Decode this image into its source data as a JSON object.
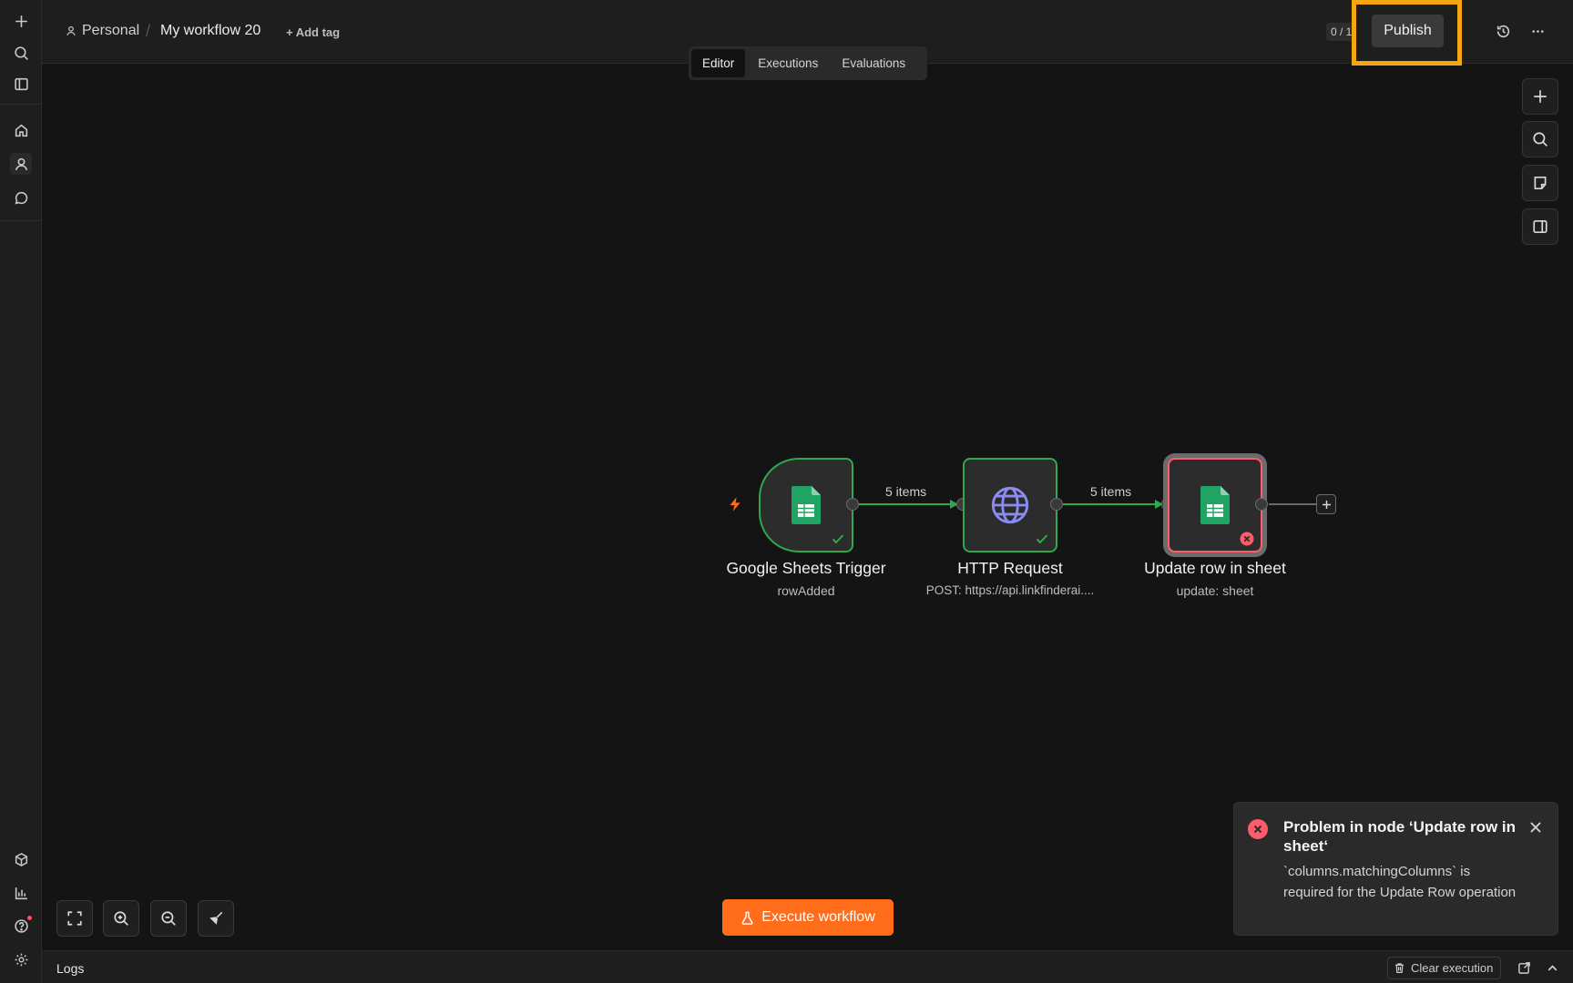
{
  "header": {
    "project": "Personal",
    "workflow_name": "My workflow 20",
    "add_tag": "+ Add tag",
    "counter": "0 / 1",
    "publish": "Publish"
  },
  "tabs": [
    {
      "label": "Editor",
      "active": true
    },
    {
      "label": "Executions",
      "active": false
    },
    {
      "label": "Evaluations",
      "active": false
    }
  ],
  "nodes": [
    {
      "name": "Google Sheets Trigger",
      "subtitle": "rowAdded",
      "status": "success",
      "icon": "google-sheets-icon"
    },
    {
      "name": "HTTP Request",
      "subtitle": "POST: https://api.linkfinderai....",
      "status": "success",
      "icon": "globe-icon"
    },
    {
      "name": "Update row in sheet",
      "subtitle": "update: sheet",
      "status": "error",
      "icon": "google-sheets-icon"
    }
  ],
  "edges": [
    {
      "label": "5 items"
    },
    {
      "label": "5 items"
    }
  ],
  "execute_button": "Execute workflow",
  "logs": {
    "title": "Logs",
    "clear_execution": "Clear execution"
  },
  "toast": {
    "title": "Problem in node ‘Update row in sheet‘",
    "message": "`columns.matchingColumns` is required for the Update Row operation"
  },
  "colors": {
    "accent_orange": "#ff6d1b",
    "success_green": "#2fa94f",
    "error_red": "#ff5c6a",
    "highlight_yellow": "#f4a50f"
  }
}
